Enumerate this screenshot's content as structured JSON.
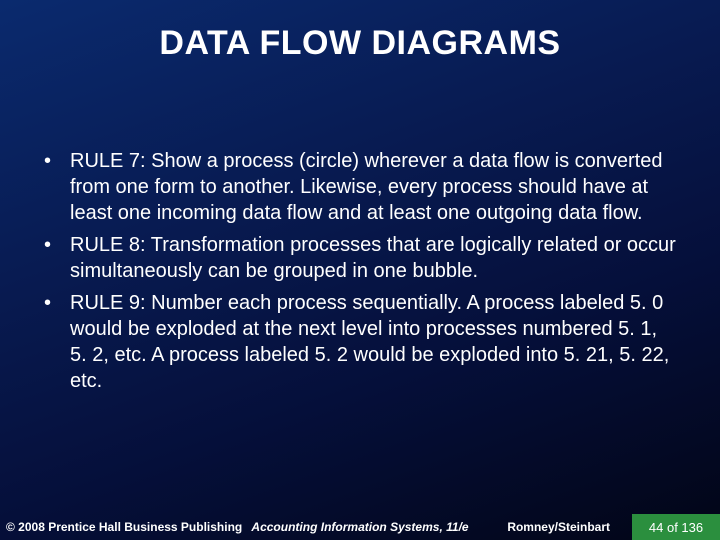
{
  "slide": {
    "title": "DATA FLOW DIAGRAMS",
    "bullets": [
      "RULE 7:  Show a process (circle) wherever a data flow is converted from one form to another. Likewise, every process should have at least one incoming data flow and at least one outgoing data flow.",
      "RULE 8:  Transformation processes that are logically related or occur simultaneously can be grouped in one bubble.",
      "RULE 9:  Number each process sequentially. A process labeled 5. 0 would be exploded at the next level into processes numbered 5. 1, 5. 2, etc.  A process labeled 5. 2 would be exploded into 5. 21, 5. 22, etc."
    ]
  },
  "footer": {
    "copyright": "© 2008 Prentice Hall Business Publishing",
    "center": "Accounting Information Systems, 11/e",
    "authors": "Romney/Steinbart",
    "page": "44 of 136"
  }
}
